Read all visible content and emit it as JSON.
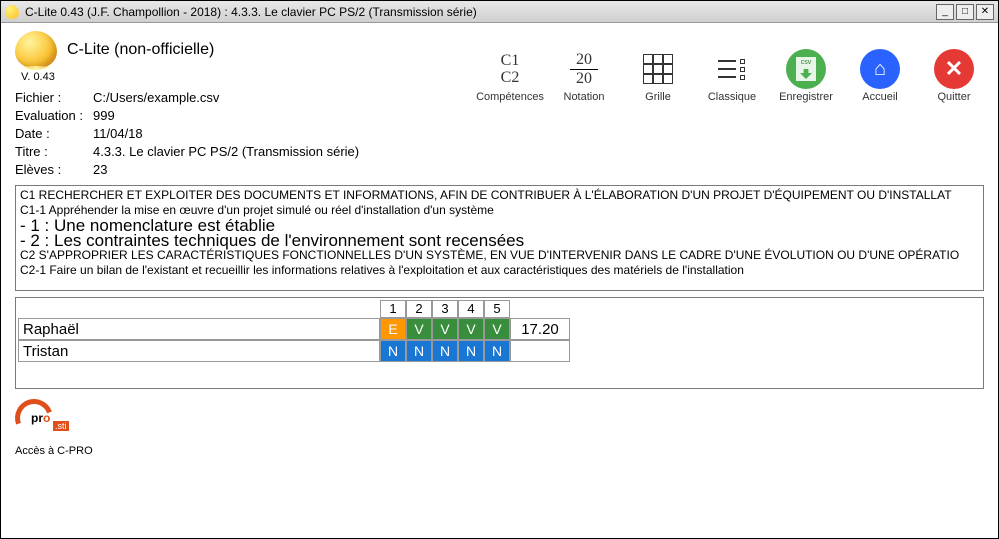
{
  "window": {
    "title": "C-Lite 0.43 (J.F. Champollion - 2018) : 4.3.3. Le clavier PC PS/2 (Transmission série)"
  },
  "app": {
    "name": "C-Lite (non-officielle)",
    "version": "V. 0.43"
  },
  "meta": {
    "fichier_label": "Fichier :",
    "fichier": "C:/Users/example.csv",
    "evaluation_label": "Evaluation :",
    "evaluation": "999",
    "date_label": "Date :",
    "date": "11/04/18",
    "titre_label": "Titre :",
    "titre": "4.3.3. Le clavier PC PS/2 (Transmission série)",
    "eleves_label": "Elèves :",
    "eleves": "23"
  },
  "toolbar": {
    "c1": "C1",
    "c2": "C2",
    "competences": "Compétences",
    "frac_top": "20",
    "frac_bot": "20",
    "notation": "Notation",
    "grille": "Grille",
    "classique": "Classique",
    "enregistrer": "Enregistrer",
    "accueil": "Accueil",
    "quitter": "Quitter",
    "csv": "csv"
  },
  "competences": {
    "c1": "C1 RECHERCHER ET EXPLOITER DES DOCUMENTS ET INFORMATIONS, AFIN DE CONTRIBUER À L'ÉLABORATION D'UN PROJET D'ÉQUIPEMENT OU D'INSTALLAT",
    "c1_1": "C1-1 Appréhender la mise en œuvre d'un projet simulé ou réel d'installation d'un système",
    "item1": "- 1 : Une nomenclature est établie",
    "item2": "- 2 : Les contraintes techniques de l'environnement sont recensées",
    "c2": "C2 S'APPROPRIER LES CARACTÉRISTIQUES FONCTIONNELLES D'UN SYSTÈME, EN VUE D'INTERVENIR DANS LE CADRE D'UNE ÉVOLUTION OU D'UNE OPÉRATIO",
    "c2_1": "C2-1 Faire un bilan de l'existant et recueillir les informations relatives à l'exploitation et aux caractéristiques des matériels de l'installation"
  },
  "grid": {
    "cols": [
      "1",
      "2",
      "3",
      "4",
      "5"
    ],
    "rows": [
      {
        "name": "Raphaël",
        "cells": [
          "E",
          "V",
          "V",
          "V",
          "V"
        ],
        "score": "17.20"
      },
      {
        "name": "Tristan",
        "cells": [
          "N",
          "N",
          "N",
          "N",
          "N"
        ],
        "score": ""
      }
    ]
  },
  "footer": {
    "pro": "pr",
    "o": "o",
    "sti": ".sti",
    "link": "Accès à C-PRO"
  }
}
